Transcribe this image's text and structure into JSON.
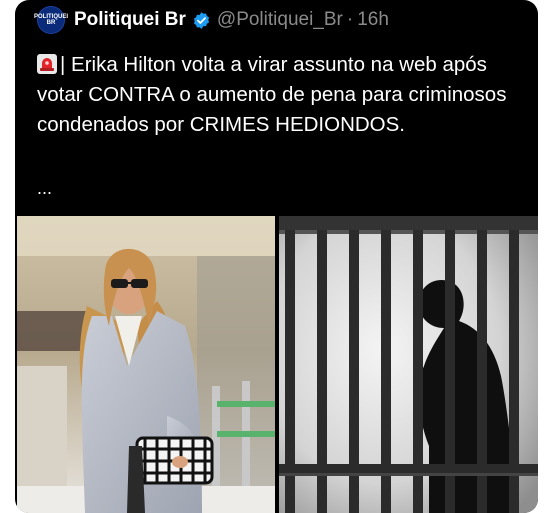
{
  "tweet": {
    "author_name": "Politiquei Br",
    "handle": "@Politiquei_Br",
    "separator": "·",
    "time": "16h",
    "avatar_line1": "POLITIQUEI",
    "avatar_line2": "BR",
    "text": "| Erika Hilton volta a virar assunto na web após votar CONTRA o aumento de pena para criminosos condenados por CRIMES HEDIONDOS.",
    "more": "..."
  },
  "icons": {
    "verified": "verified-badge-icon",
    "siren": "siren-icon"
  },
  "colors": {
    "background": "#000000",
    "text": "#ffffff",
    "muted": "#8b8b8b",
    "verified": "#1d9bf0",
    "avatar": "#0a2a7a"
  },
  "media": {
    "left_image": "woman-in-gray-coat-photo",
    "right_image": "man-behind-prison-bars-silhouette"
  }
}
